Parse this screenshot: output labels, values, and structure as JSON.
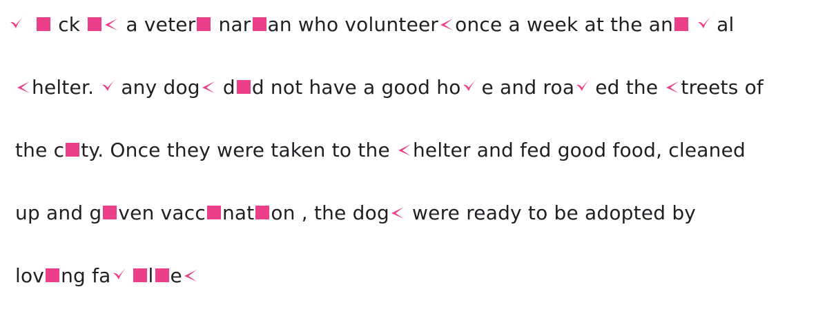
{
  "accent_color": "#ec3f8a",
  "text_color": "#1f1f24",
  "lines": [
    [
      {
        "t": "sym",
        "k": "check"
      },
      {
        "t": "txt",
        "v": " "
      },
      {
        "t": "sym",
        "k": "square"
      },
      {
        "t": "txt",
        "v": " ck "
      },
      {
        "t": "sym",
        "k": "square"
      },
      {
        "t": "sym",
        "k": "arrow"
      },
      {
        "t": "txt",
        "v": " a veter"
      },
      {
        "t": "sym",
        "k": "square"
      },
      {
        "t": "txt",
        "v": " nar"
      },
      {
        "t": "sym",
        "k": "square"
      },
      {
        "t": "txt",
        "v": "an who volunteer"
      },
      {
        "t": "sym",
        "k": "arrow"
      },
      {
        "t": "txt",
        "v": "once a week at the an"
      },
      {
        "t": "sym",
        "k": "square"
      },
      {
        "t": "txt",
        "v": " "
      },
      {
        "t": "sym",
        "k": "check"
      },
      {
        "t": "txt",
        "v": "al"
      }
    ],
    [
      {
        "t": "sym",
        "k": "arrow"
      },
      {
        "t": "txt",
        "v": "helter. "
      },
      {
        "t": "sym",
        "k": "check"
      },
      {
        "t": "txt",
        "v": "any dog"
      },
      {
        "t": "sym",
        "k": "arrow"
      },
      {
        "t": "txt",
        "v": " d"
      },
      {
        "t": "sym",
        "k": "square"
      },
      {
        "t": "txt",
        "v": "d not have a good ho"
      },
      {
        "t": "sym",
        "k": "check"
      },
      {
        "t": "txt",
        "v": "e and roa"
      },
      {
        "t": "sym",
        "k": "check"
      },
      {
        "t": "txt",
        "v": "ed the "
      },
      {
        "t": "sym",
        "k": "arrow"
      },
      {
        "t": "txt",
        "v": "treets of"
      }
    ],
    [
      {
        "t": "txt",
        "v": "the c"
      },
      {
        "t": "sym",
        "k": "square"
      },
      {
        "t": "txt",
        "v": "ty. Once they were taken to the "
      },
      {
        "t": "sym",
        "k": "arrow"
      },
      {
        "t": "txt",
        "v": "helter and fed good food, cleaned"
      }
    ],
    [
      {
        "t": "txt",
        "v": "up and g"
      },
      {
        "t": "sym",
        "k": "square"
      },
      {
        "t": "txt",
        "v": "ven vacc"
      },
      {
        "t": "sym",
        "k": "square"
      },
      {
        "t": "txt",
        "v": "nat"
      },
      {
        "t": "sym",
        "k": "square"
      },
      {
        "t": "txt",
        "v": "on , the dog"
      },
      {
        "t": "sym",
        "k": "arrow"
      },
      {
        "t": "txt",
        "v": " were ready to be adopted by"
      }
    ],
    [
      {
        "t": "txt",
        "v": "lov"
      },
      {
        "t": "sym",
        "k": "square"
      },
      {
        "t": "txt",
        "v": "ng fa"
      },
      {
        "t": "sym",
        "k": "check"
      },
      {
        "t": "sym",
        "k": "square"
      },
      {
        "t": "txt",
        "v": "l"
      },
      {
        "t": "sym",
        "k": "square"
      },
      {
        "t": "txt",
        "v": "e"
      },
      {
        "t": "sym",
        "k": "arrow"
      }
    ]
  ]
}
